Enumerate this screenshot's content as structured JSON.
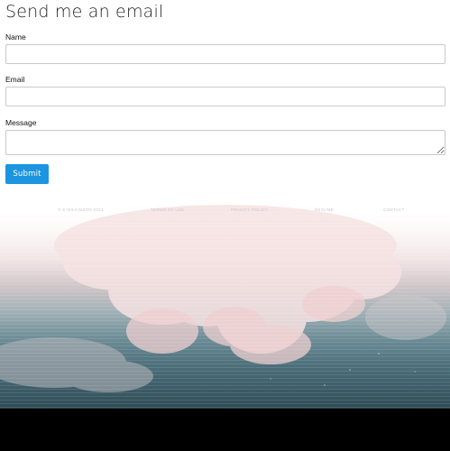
{
  "form": {
    "title": "Send me an email",
    "name_label": "Name",
    "name_value": "",
    "email_label": "Email",
    "email_value": "",
    "message_label": "Message",
    "message_value": "",
    "submit_label": "Submit"
  },
  "footer": {
    "links": [
      {
        "label": "© S WILKINSON 2021"
      },
      {
        "label": "TERMS OF USE"
      },
      {
        "label": "PRIVACY POLICY"
      },
      {
        "label": "RESUME"
      },
      {
        "label": "CONTACT"
      }
    ]
  },
  "colors": {
    "accent": "#1b95e0",
    "input_border": "#c9c9c9",
    "footer_text": "#c7c7c7",
    "cloud_pink": "#f3dcdc",
    "sky_teal": "#3a5a65",
    "bottom_band": "#000000"
  }
}
